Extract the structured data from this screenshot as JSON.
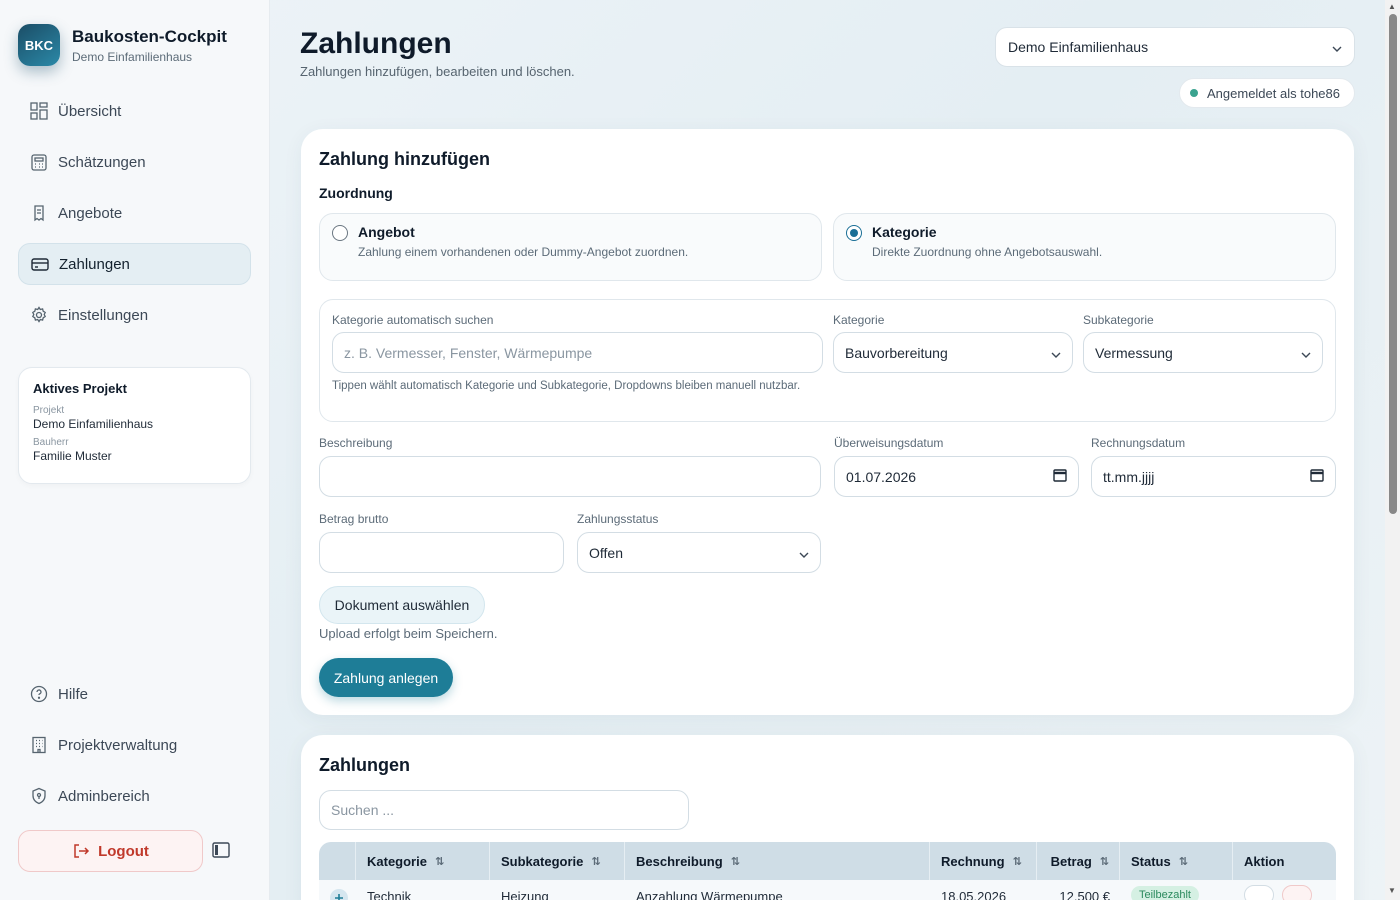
{
  "brand": {
    "logo": "BKC",
    "title": "Baukosten-Cockpit",
    "subtitle": "Demo Einfamilienhaus"
  },
  "nav": [
    {
      "label": "Übersicht",
      "icon": "dashboard-icon"
    },
    {
      "label": "Schätzungen",
      "icon": "calculator-icon"
    },
    {
      "label": "Angebote",
      "icon": "receipt-icon"
    },
    {
      "label": "Zahlungen",
      "icon": "wallet-icon",
      "active": true
    },
    {
      "label": "Einstellungen",
      "icon": "gear-icon"
    }
  ],
  "project_card": {
    "title": "Aktives Projekt",
    "project_label": "Projekt",
    "project_value": "Demo Einfamilienhaus",
    "owner_label": "Bauherr",
    "owner_value": "Familie Muster"
  },
  "nav_bottom": [
    {
      "label": "Hilfe",
      "icon": "help-icon"
    },
    {
      "label": "Projektverwaltung",
      "icon": "building-icon"
    },
    {
      "label": "Adminbereich",
      "icon": "shield-icon"
    }
  ],
  "logout_label": "Logout",
  "header": {
    "title": "Zahlungen",
    "subtitle": "Zahlungen hinzufügen, bearbeiten und löschen.",
    "project_select": "Demo Einfamilienhaus",
    "login_text": "Angemeldet als tohe86"
  },
  "form": {
    "title": "Zahlung hinzufügen",
    "assignment_label": "Zuordnung",
    "option_offer": {
      "title": "Angebot",
      "desc": "Zahlung einem vorhandenen oder Dummy-Angebot zuordnen.",
      "selected": false
    },
    "option_category": {
      "title": "Kategorie",
      "desc": "Direkte Zuordnung ohne Angebotsauswahl.",
      "selected": true
    },
    "auto_search_label": "Kategorie automatisch suchen",
    "auto_search_placeholder": "z. B. Vermesser, Fenster, Wärmepumpe",
    "category_label": "Kategorie",
    "category_value": "Bauvorbereitung",
    "subcategory_label": "Subkategorie",
    "subcategory_value": "Vermessung",
    "hint": "Tippen wählt automatisch Kategorie und Subkategorie, Dropdowns bleiben manuell nutzbar.",
    "description_label": "Beschreibung",
    "description_value": "",
    "transfer_date_label": "Überweisungsdatum",
    "transfer_date_value": "01.07.2026",
    "invoice_date_label": "Rechnungsdatum",
    "invoice_date_placeholder": "tt.mm.jjjj",
    "amount_label": "Betrag brutto",
    "amount_value": "",
    "status_label": "Zahlungsstatus",
    "status_value": "Offen",
    "document_button": "Dokument auswählen",
    "upload_note": "Upload erfolgt beim Speichern.",
    "submit_button": "Zahlung anlegen"
  },
  "table": {
    "title": "Zahlungen",
    "search_placeholder": "Suchen ...",
    "columns": [
      "Kategorie",
      "Subkategorie",
      "Beschreibung",
      "Rechnung",
      "Betrag",
      "Status",
      "Aktion"
    ],
    "rows": [
      {
        "kategorie": "Technik",
        "subkategorie": "Heizung",
        "beschreibung": "Anzahlung Wärmepumpe",
        "rechnung": "18.05.2026",
        "betrag": "12.500 €",
        "status": "Teilbezahlt"
      }
    ]
  },
  "colors": {
    "accent": "#1e7d97",
    "logout": "#c0392b",
    "online": "#3aa38f"
  }
}
